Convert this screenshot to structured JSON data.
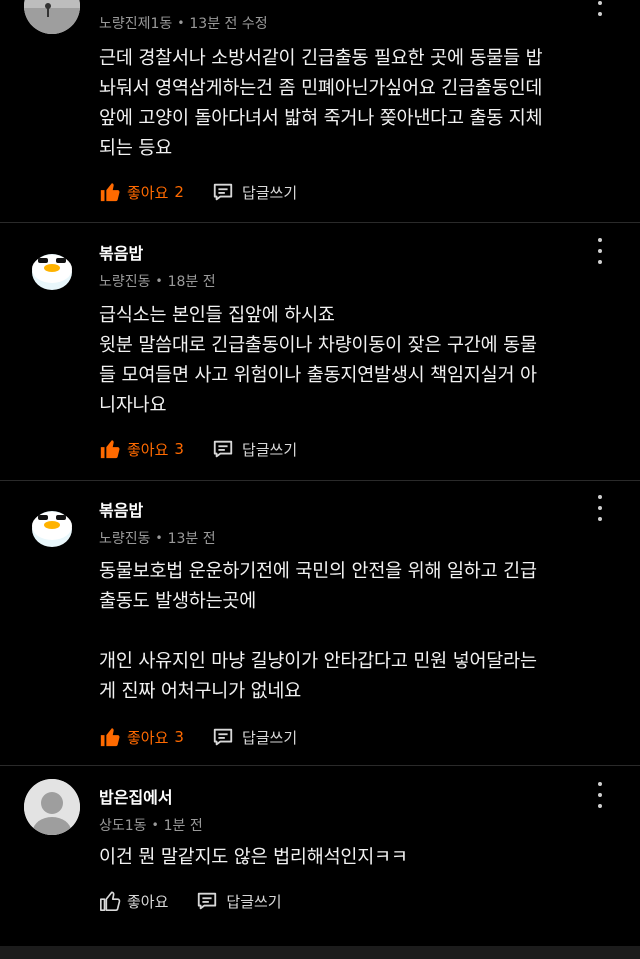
{
  "comments": [
    {
      "author": "",
      "location": "노량진제1동",
      "time": "13분 전 수정",
      "text": "근데 경찰서나 소방서같이 긴급출동 필요한 곳에 동물들 밥\n놔둬서 영역삼게하는건 좀 민폐아닌가싶어요 긴급출동인데\n앞에 고양이 돌아다녀서 밟혀 죽거나 쫒아낸다고 출동 지체\n되는 등요",
      "like_label": "좋아요",
      "like_count": "2",
      "reply_label": "답글쓰기"
    },
    {
      "author": "볶음밥",
      "location": "노량진동",
      "time": "18분 전",
      "text": "급식소는 본인들 집앞에 하시죠\n윗분 말씀대로 긴급출동이나 차량이동이 잦은 구간에 동물\n들 모여들면 사고 위험이나 출동지연발생시 책임지실거 아\n니자나요",
      "like_label": "좋아요",
      "like_count": "3",
      "reply_label": "답글쓰기"
    },
    {
      "author": "볶음밥",
      "location": "노량진동",
      "time": "13분 전",
      "text": "동물보호법 운운하기전에 국민의 안전을 위해 일하고 긴급\n출동도 발생하는곳에\n\n개인 사유지인 마냥 길냥이가 안타갑다고 민원 넣어달라는\n게 진짜 어처구니가 없네요",
      "like_label": "좋아요",
      "like_count": "3",
      "reply_label": "답글쓰기"
    },
    {
      "author": "밥은집에서",
      "location": "상도1동",
      "time": "1분 전",
      "text": "이건 뭔 말같지도 않은 법리해석인지ㅋㅋ",
      "like_label": "좋아요",
      "like_count": "",
      "reply_label": "답글쓰기"
    }
  ],
  "colors": {
    "accent": "#ff6a00",
    "background": "#000000",
    "meta_text": "#9a9a9a"
  },
  "icons": {
    "like": "thumbs-up-icon",
    "reply": "speech-bubble-icon",
    "more": "more-vertical-icon"
  }
}
